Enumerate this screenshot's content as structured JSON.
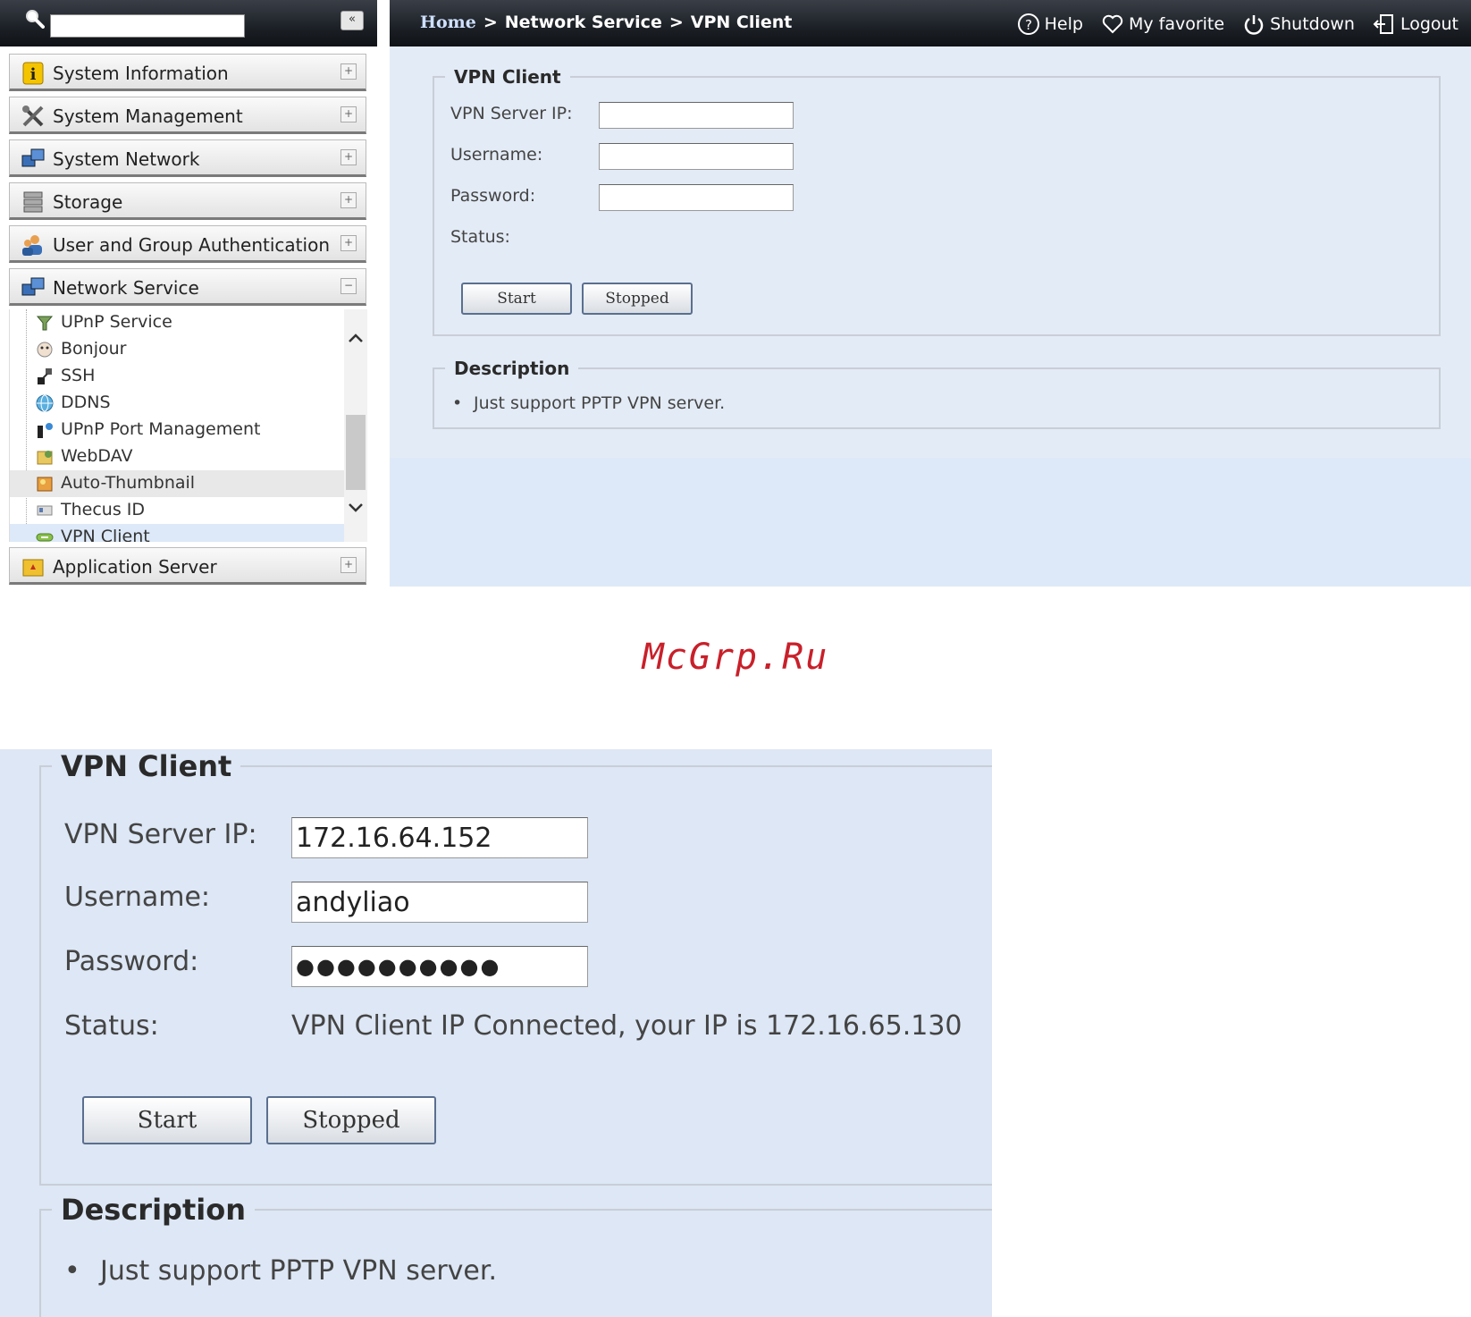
{
  "search": {
    "placeholder": "",
    "collapse_label": "«"
  },
  "header": {
    "breadcrumb": {
      "home": "Home",
      "sep": ">",
      "section": "Network Service",
      "page": "VPN Client"
    },
    "links": {
      "help": "Help",
      "favorite": "My favorite",
      "shutdown": "Shutdown",
      "logout": "Logout"
    }
  },
  "sidebar": {
    "categories": [
      {
        "label": "System Information",
        "toggle": "+"
      },
      {
        "label": "System Management",
        "toggle": "+"
      },
      {
        "label": "System Network",
        "toggle": "+"
      },
      {
        "label": "Storage",
        "toggle": "+"
      },
      {
        "label": "User and Group Authentication",
        "toggle": "+"
      },
      {
        "label": "Network Service",
        "toggle": "−"
      },
      {
        "label": "Application Server",
        "toggle": "+"
      }
    ],
    "network_service_items": [
      {
        "label": "UPnP Service"
      },
      {
        "label": "Bonjour"
      },
      {
        "label": "SSH"
      },
      {
        "label": "DDNS"
      },
      {
        "label": "UPnP Port Management"
      },
      {
        "label": "WebDAV"
      },
      {
        "label": "Auto-Thumbnail"
      },
      {
        "label": "Thecus ID"
      },
      {
        "label": "VPN Client"
      }
    ],
    "active_item": "VPN Client"
  },
  "vpn_form_empty": {
    "legend": "VPN Client",
    "server_ip_label": "VPN Server IP:",
    "server_ip_value": "",
    "username_label": "Username:",
    "username_value": "",
    "password_label": "Password:",
    "password_value": "",
    "status_label": "Status:",
    "status_value": "",
    "start_label": "Start",
    "stopped_label": "Stopped"
  },
  "description_top": {
    "legend": "Description",
    "items": [
      "Just support PPTP VPN server."
    ]
  },
  "watermark": "McGrp.Ru",
  "vpn_form_filled": {
    "legend": "VPN Client",
    "server_ip_label": "VPN Server IP:",
    "server_ip_value": "172.16.64.152",
    "username_label": "Username:",
    "username_value": "andyliao",
    "password_label": "Password:",
    "password_value": "●●●●●●●●●●",
    "status_label": "Status:",
    "status_value": "VPN Client IP Connected, your IP is 172.16.65.130",
    "start_label": "Start",
    "stopped_label": "Stopped"
  },
  "description_bottom": {
    "legend": "Description",
    "items": [
      "Just support PPTP VPN server."
    ]
  },
  "colors": {
    "panel_bg": "#e3ebf6",
    "header_bg": "#1c2026",
    "active_item_bg": "#dde9f8",
    "watermark": "#c8202a"
  }
}
